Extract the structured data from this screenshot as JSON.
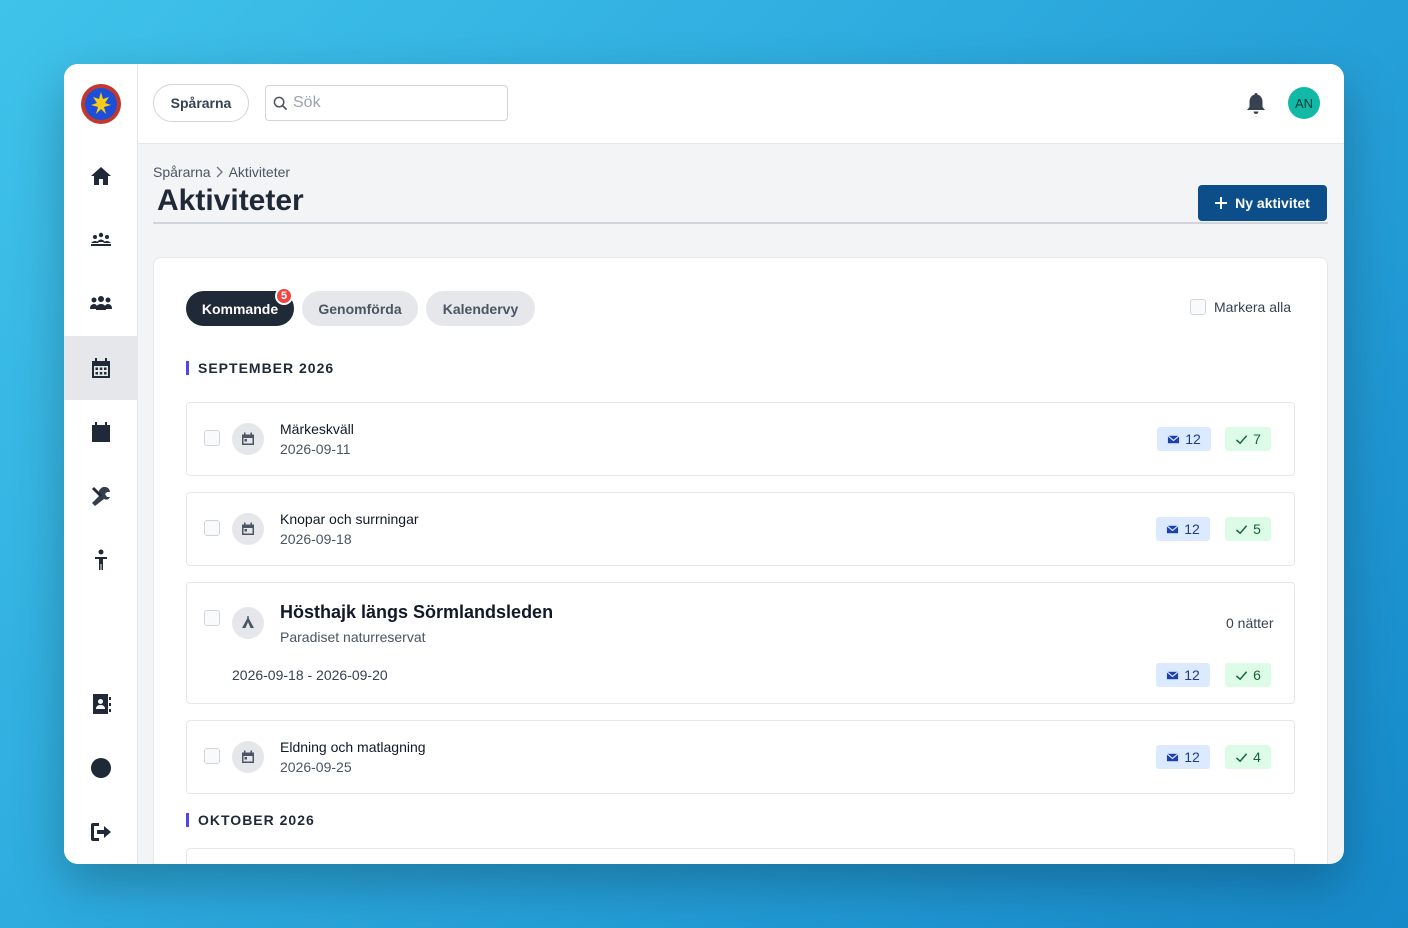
{
  "topbar": {
    "org_button": "Spårarna",
    "search_placeholder": "Sök",
    "avatar_initials": "AN"
  },
  "breadcrumb": [
    "Spårarna",
    "Aktiviteter"
  ],
  "page": {
    "title": "Aktiviteter",
    "new_button": "Ny aktivitet"
  },
  "tabs": [
    {
      "label": "Kommande",
      "active": true,
      "badge": "5"
    },
    {
      "label": "Genomförda",
      "active": false
    },
    {
      "label": "Kalendervy",
      "active": false
    }
  ],
  "select_all_label": "Markera alla",
  "months": [
    {
      "label": "SEPTEMBER 2026",
      "activities": [
        {
          "title": "Märkeskväll",
          "date": "2026-09-11",
          "icon": "calendar-icon",
          "invited": "12",
          "accepted": "7"
        },
        {
          "title": "Knopar och surrningar",
          "date": "2026-09-18",
          "icon": "calendar-icon",
          "invited": "12",
          "accepted": "5"
        },
        {
          "title": "Hösthajk längs Sörmlandsleden",
          "location": "Paradiset naturreservat",
          "date_range": "2026-09-18 - 2026-09-20",
          "nights": "0 nätter",
          "icon": "tent-icon",
          "invited": "12",
          "accepted": "6"
        },
        {
          "title": "Eldning och matlagning",
          "date": "2026-09-25",
          "icon": "calendar-icon",
          "invited": "12",
          "accepted": "4"
        }
      ]
    },
    {
      "label": "OKTOBER 2026",
      "activities": []
    }
  ],
  "colors": {
    "primary": "#0b4e8a",
    "active_tab": "#1f2937",
    "badge": "#ef4444",
    "month_marker": "#4f46e5",
    "avatar": "#14b8a6"
  }
}
